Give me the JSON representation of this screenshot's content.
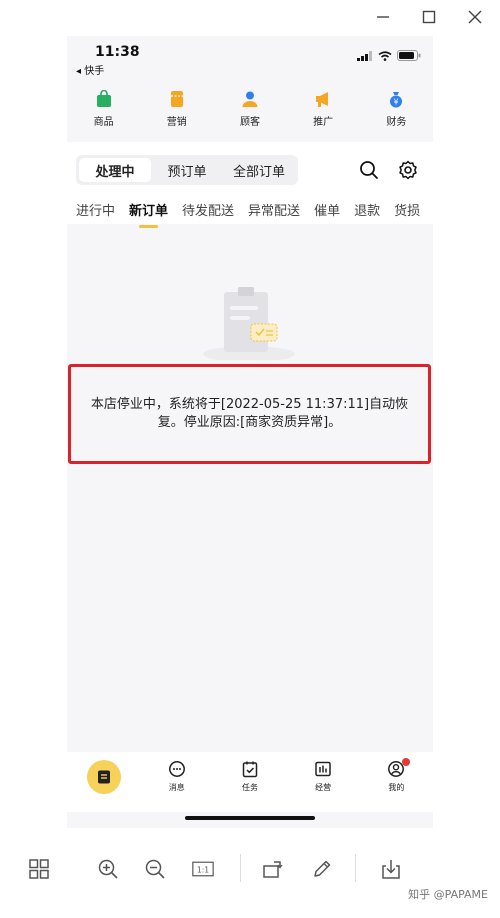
{
  "window": {
    "controls": [
      "minimize-icon",
      "maximize-icon",
      "close-icon"
    ]
  },
  "status_bar": {
    "time": "11:38",
    "back_app": "◂ 快手"
  },
  "quick_nav": [
    {
      "label": "商品",
      "icon": "bag-icon",
      "color": "#27ae60"
    },
    {
      "label": "营销",
      "icon": "ticket-icon",
      "color": "#f5a623"
    },
    {
      "label": "顾客",
      "icon": "customer-icon",
      "color": "#2f80ed"
    },
    {
      "label": "推广",
      "icon": "megaphone-icon",
      "color": "#f5a623"
    },
    {
      "label": "财务",
      "icon": "money-bag-icon",
      "color": "#2f80ed"
    }
  ],
  "segments": [
    "处理中",
    "预订单",
    "全部订单"
  ],
  "sub_tabs": [
    "进行中",
    "新订单",
    "待发配送",
    "异常配送",
    "催单",
    "退款",
    "货损"
  ],
  "notice": "本店停业中，系统将于[2022-05-25 11:37:11]自动恢复。停业原因:[商家资质异常]。",
  "bottom_nav": [
    {
      "label": "",
      "icon": "order-book-icon"
    },
    {
      "label": "消息",
      "icon": "message-icon"
    },
    {
      "label": "任务",
      "icon": "task-icon"
    },
    {
      "label": "经营",
      "icon": "business-icon"
    },
    {
      "label": "我的",
      "icon": "profile-icon"
    }
  ],
  "viewer_toolbar": {
    "one_to_one": "1:1"
  },
  "watermark": "知乎 @PAPAME",
  "colors": {
    "accent": "#f3c13b",
    "notice_border": "#d9232a",
    "badge": "#e53935"
  }
}
